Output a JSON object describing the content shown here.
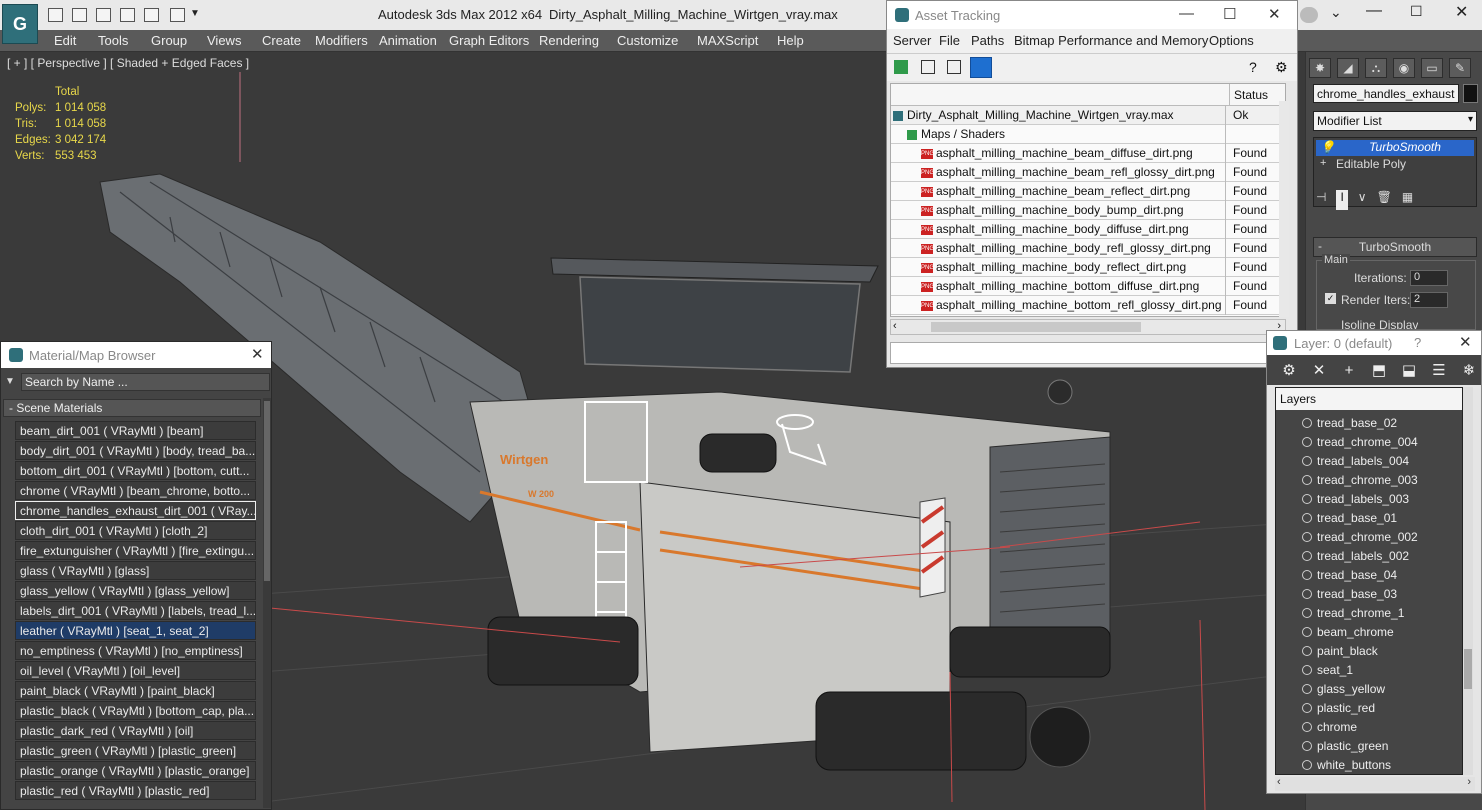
{
  "app": {
    "title": "Autodesk 3ds Max  2012 x64",
    "file": "Dirty_Asphalt_Milling_Machine_Wirtgen_vray.max",
    "logo_icon": "3dsmax-logo-icon"
  },
  "menu": [
    "Edit",
    "Tools",
    "Group",
    "Views",
    "Create",
    "Modifiers",
    "Animation",
    "Graph Editors",
    "Rendering",
    "Customize",
    "MAXScript",
    "Help"
  ],
  "viewport": {
    "label": "[ + ] [ Perspective ] [ Shaded + Edged Faces ]",
    "stats_header": "Total",
    "stats": [
      {
        "label": "Polys:",
        "value": "1 014 058"
      },
      {
        "label": "Tris:",
        "value": "1 014 058"
      },
      {
        "label": "Edges:",
        "value": "3 042 174"
      },
      {
        "label": "Verts:",
        "value": "553 453"
      }
    ],
    "brand_text": "Wirtgen",
    "model_text": "W 200"
  },
  "command_panel": {
    "object_name": "chrome_handles_exhaust",
    "modifier_list": "Modifier List",
    "stack": [
      "TurboSmooth",
      "Editable Poly"
    ],
    "rollout_title": "TurboSmooth",
    "group_main": "Main",
    "iterations_label": "Iterations:",
    "iterations_value": "0",
    "render_iters_label": "Render Iters:",
    "render_iters_value": "2",
    "isoline_label": "Isoline Display"
  },
  "asset_tracking": {
    "title": "Asset Tracking",
    "menu": [
      "Server",
      "File",
      "Paths",
      "Bitmap Performance and Memory",
      "Options"
    ],
    "status_header": "Status",
    "rows": [
      {
        "name": "Dirty_Asphalt_Milling_Machine_Wirtgen_vray.max",
        "status": "Ok",
        "kind": "max"
      },
      {
        "name": "Maps / Shaders",
        "status": "",
        "kind": "folder"
      },
      {
        "name": "asphalt_milling_machine_beam_diffuse_dirt.png",
        "status": "Found",
        "kind": "png"
      },
      {
        "name": "asphalt_milling_machine_beam_refl_glossy_dirt.png",
        "status": "Found",
        "kind": "png"
      },
      {
        "name": "asphalt_milling_machine_beam_reflect_dirt.png",
        "status": "Found",
        "kind": "png"
      },
      {
        "name": "asphalt_milling_machine_body_bump_dirt.png",
        "status": "Found",
        "kind": "png"
      },
      {
        "name": "asphalt_milling_machine_body_diffuse_dirt.png",
        "status": "Found",
        "kind": "png"
      },
      {
        "name": "asphalt_milling_machine_body_refl_glossy_dirt.png",
        "status": "Found",
        "kind": "png"
      },
      {
        "name": "asphalt_milling_machine_body_reflect_dirt.png",
        "status": "Found",
        "kind": "png"
      },
      {
        "name": "asphalt_milling_machine_bottom_diffuse_dirt.png",
        "status": "Found",
        "kind": "png"
      },
      {
        "name": "asphalt_milling_machine_bottom_refl_glossy_dirt.png",
        "status": "Found",
        "kind": "png"
      }
    ]
  },
  "material_browser": {
    "title": "Material/Map Browser",
    "search_placeholder": "Search by Name ...",
    "section": "- Scene Materials",
    "items": [
      "beam_dirt_001  ( VRayMtl ) [beam]",
      "body_dirt_001  ( VRayMtl ) [body, tread_ba...",
      "bottom_dirt_001  ( VRayMtl ) [bottom, cutt...",
      "chrome  ( VRayMtl ) [beam_chrome, botto...",
      "chrome_handles_exhaust_dirt_001  ( VRay...",
      "cloth_dirt_001  ( VRayMtl ) [cloth_2]",
      "fire_extunguisher  ( VRayMtl ) [fire_extingu...",
      "glass  ( VRayMtl ) [glass]",
      "glass_yellow  ( VRayMtl ) [glass_yellow]",
      "labels_dirt_001  ( VRayMtl ) [labels, tread_l...",
      "leather  ( VRayMtl ) [seat_1, seat_2]",
      "no_emptiness  ( VRayMtl ) [no_emptiness]",
      "oil_level  ( VRayMtl ) [oil_level]",
      "paint_black  ( VRayMtl ) [paint_black]",
      "plastic_black  ( VRayMtl ) [bottom_cap, pla...",
      "plastic_dark_red  ( VRayMtl ) [oil]",
      "plastic_green  ( VRayMtl ) [plastic_green]",
      "plastic_orange  ( VRayMtl ) [plastic_orange]",
      "plastic_red  ( VRayMtl ) [plastic_red]"
    ],
    "highlighted_index": 10,
    "outlined_index": 4
  },
  "layer_window": {
    "title": "Layer: 0 (default)",
    "help": "?",
    "header": "Layers",
    "items": [
      "tread_base_02",
      "tread_chrome_004",
      "tread_labels_004",
      "tread_chrome_003",
      "tread_labels_003",
      "tread_base_01",
      "tread_chrome_002",
      "tread_labels_002",
      "tread_base_04",
      "tread_base_03",
      "tread_chrome_1",
      "beam_chrome",
      "paint_black",
      "seat_1",
      "glass_yellow",
      "plastic_red",
      "chrome",
      "plastic_green",
      "white_buttons"
    ]
  },
  "colors": {
    "viewport_bg": "#3a3a3a",
    "stat_yellow": "#e8d84a",
    "selection_blue": "#1f3c67",
    "brand_orange": "#d9782c"
  }
}
